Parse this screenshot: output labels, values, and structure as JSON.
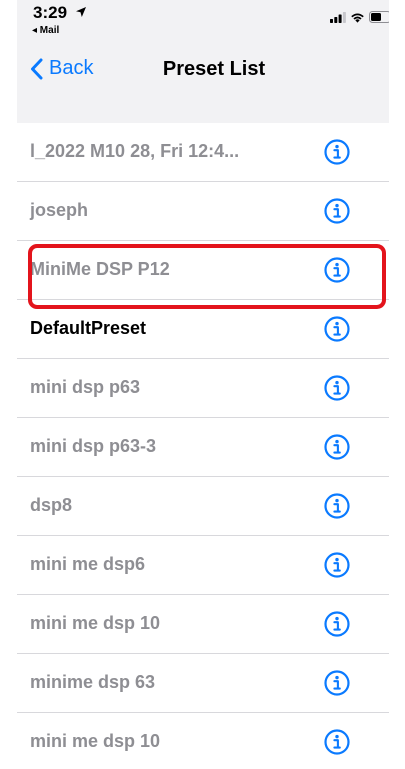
{
  "status_bar": {
    "time": "3:29",
    "back_app": "◂ Mail"
  },
  "nav": {
    "back_label": "Back",
    "title": "Preset List"
  },
  "colors": {
    "accent": "#0a7aff",
    "highlight": "#e3141c",
    "inactive_text": "#8e8e93",
    "active_text": "#000000"
  },
  "presets": [
    {
      "label": "l_2022 M10 28, Fri 12:4...",
      "active": false
    },
    {
      "label": "joseph",
      "active": false
    },
    {
      "label": "MiniMe DSP P12",
      "active": false,
      "highlighted": true
    },
    {
      "label": "DefaultPreset",
      "active": true
    },
    {
      "label": "mini dsp p63",
      "active": false
    },
    {
      "label": "mini dsp p63-3",
      "active": false
    },
    {
      "label": "dsp8",
      "active": false
    },
    {
      "label": "mini me dsp6",
      "active": false
    },
    {
      "label": "mini me dsp 10",
      "active": false
    },
    {
      "label": "minime dsp 63",
      "active": false
    },
    {
      "label": "mini me dsp 10",
      "active": false
    }
  ],
  "icons": {
    "info": "info-circle-icon",
    "back": "chevron-left-icon",
    "signal": "cellular-signal-icon",
    "wifi": "wifi-icon",
    "battery": "battery-icon",
    "location": "location-arrow-icon"
  }
}
